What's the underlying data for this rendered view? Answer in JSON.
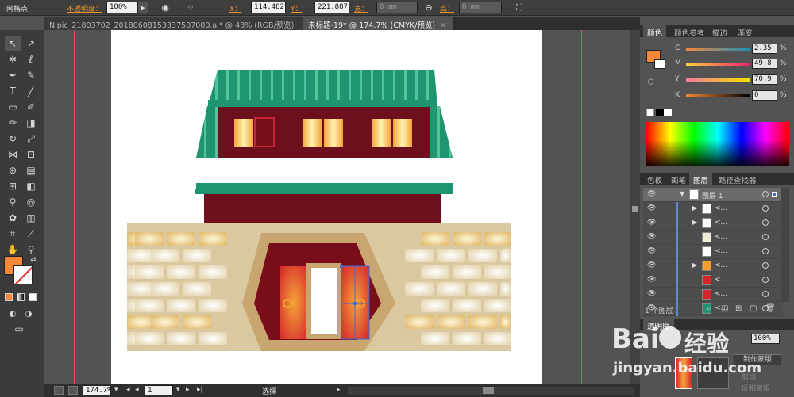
{
  "control_bar": {
    "mode_label": "网格点",
    "opacity_label": "不透明度：",
    "opacity_value": "100%",
    "x_label": "X：",
    "x_value": "114.482 n",
    "y_label": "Y：",
    "y_value": "221.887 n",
    "w_label": "宽：",
    "w_value": "0 mm",
    "h_label": "高：",
    "h_value": "0 mm"
  },
  "tabs": [
    {
      "label": "Nipic_21803702_20180608153337507000.ai* @ 48% (RGB/预览)",
      "active": false
    },
    {
      "label": "未标题-19* @ 174.7% (CMYK/预览)",
      "active": true
    }
  ],
  "tab_close_glyph": "✕",
  "color_panel": {
    "tabs": [
      "颜色",
      "颜色参考",
      "描边",
      "渐变"
    ],
    "channels": [
      {
        "label": "C",
        "value": "2.35"
      },
      {
        "label": "M",
        "value": "49.8"
      },
      {
        "label": "Y",
        "value": "70.9"
      },
      {
        "label": "K",
        "value": "0"
      }
    ],
    "percent": "%",
    "fill_color": "#f7883a"
  },
  "layers_panel": {
    "tabs": [
      "色板",
      "画笔",
      "图层",
      "路径查找器"
    ],
    "top_layer": "图层 1",
    "sublayer_label": "<...",
    "sublayer_count": 8,
    "layer_count": "1 个图层"
  },
  "transparency_panel": {
    "title": "透明度",
    "opacity": "100%",
    "make_mask": "制作蒙版",
    "clip": "剪切",
    "invert_mask": "反相蒙版"
  },
  "status_bar": {
    "zoom": "174.7%",
    "page": "1",
    "tool": "选择"
  },
  "watermark": {
    "brand": "Bai",
    "brand2": "经验",
    "url": "jingyan.baidu.com"
  }
}
